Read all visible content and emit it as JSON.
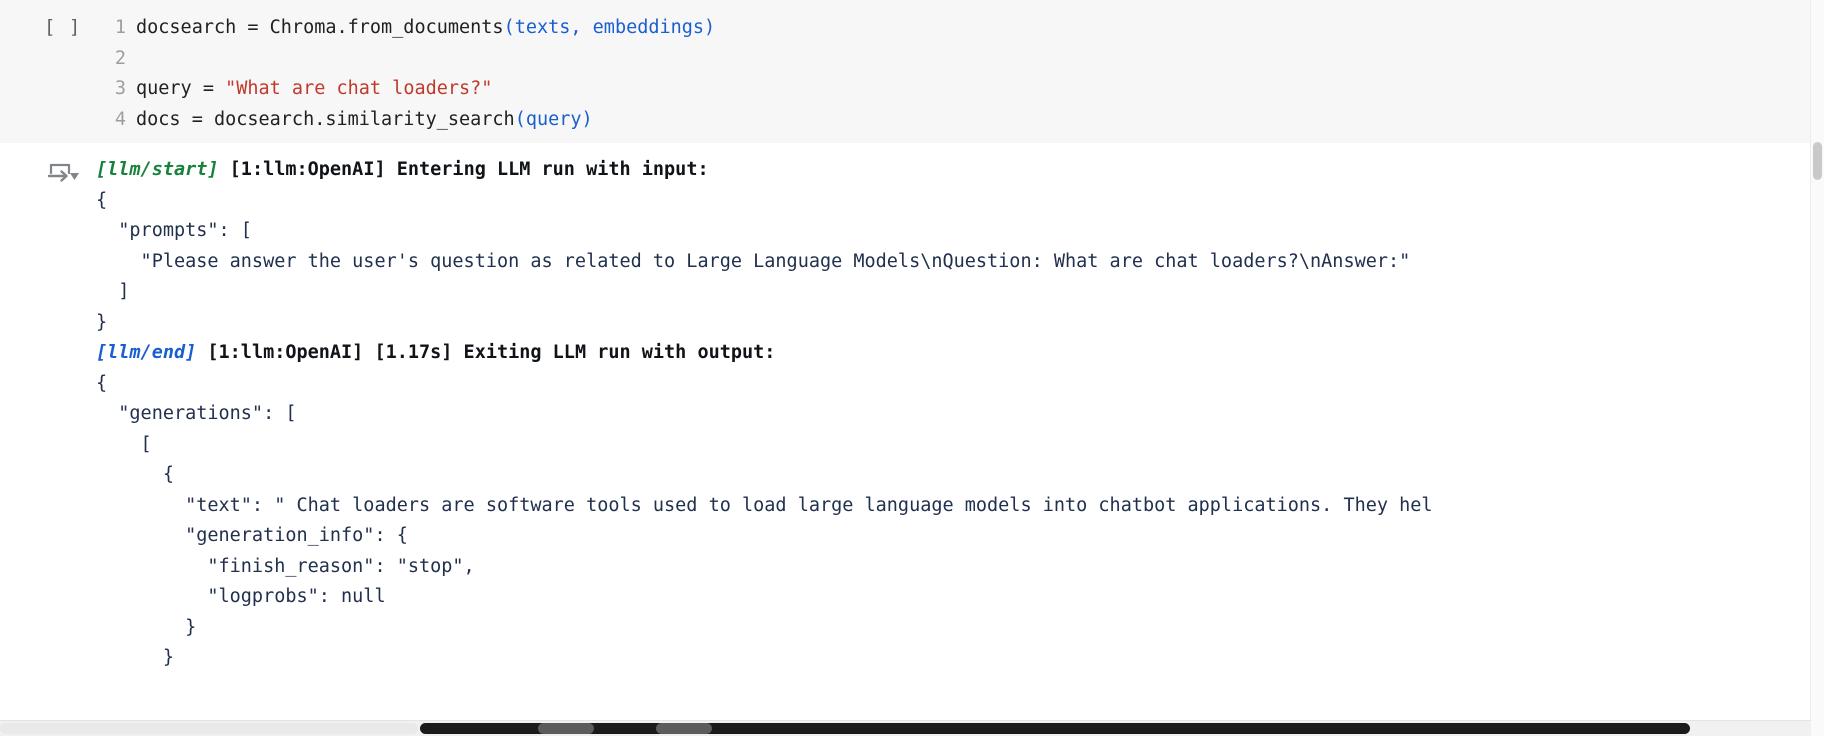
{
  "cell": {
    "run_prompt": "[ ]",
    "code_lines": [
      {
        "number": "1",
        "tokens": [
          {
            "t": "docsearch = Chroma.from_documents",
            "k": "plain"
          },
          {
            "t": "(texts, embeddings)",
            "k": "paren"
          }
        ]
      },
      {
        "number": "2",
        "tokens": [
          {
            "t": "",
            "k": "plain"
          }
        ]
      },
      {
        "number": "3",
        "tokens": [
          {
            "t": "query = ",
            "k": "plain"
          },
          {
            "t": "\"What are chat loaders?\"",
            "k": "str"
          }
        ]
      },
      {
        "number": "4",
        "tokens": [
          {
            "t": "docs = docsearch.similarity_search",
            "k": "plain"
          },
          {
            "t": "(query)",
            "k": "paren"
          }
        ]
      }
    ]
  },
  "output": {
    "icon": "output-scroll-toggle-icon",
    "lines": [
      {
        "segments": [
          {
            "t": "[llm/start]",
            "k": "start"
          },
          {
            "t": " [1:llm:OpenAI] Entering LLM run with input:",
            "k": "header"
          }
        ]
      },
      {
        "segments": [
          {
            "t": "{",
            "k": "body"
          }
        ]
      },
      {
        "segments": [
          {
            "t": "  \"prompts\": [",
            "k": "body"
          }
        ]
      },
      {
        "segments": [
          {
            "t": "    \"Please answer the user's question as related to Large Language Models\\nQuestion: What are chat loaders?\\nAnswer:\"",
            "k": "body"
          }
        ]
      },
      {
        "segments": [
          {
            "t": "  ]",
            "k": "body"
          }
        ]
      },
      {
        "segments": [
          {
            "t": "}",
            "k": "body"
          }
        ]
      },
      {
        "segments": [
          {
            "t": "[llm/end]",
            "k": "end"
          },
          {
            "t": " [1:llm:OpenAI] [1.17s] Exiting LLM run with output:",
            "k": "header"
          }
        ]
      },
      {
        "segments": [
          {
            "t": "{",
            "k": "body"
          }
        ]
      },
      {
        "segments": [
          {
            "t": "  \"generations\": [",
            "k": "body"
          }
        ]
      },
      {
        "segments": [
          {
            "t": "    [",
            "k": "body"
          }
        ]
      },
      {
        "segments": [
          {
            "t": "      {",
            "k": "body"
          }
        ]
      },
      {
        "segments": [
          {
            "t": "        \"text\": \" Chat loaders are software tools used to load large language models into chatbot applications. They hel",
            "k": "body"
          }
        ]
      },
      {
        "segments": [
          {
            "t": "        \"generation_info\": {",
            "k": "body"
          }
        ]
      },
      {
        "segments": [
          {
            "t": "          \"finish_reason\": \"stop\",",
            "k": "body"
          }
        ]
      },
      {
        "segments": [
          {
            "t": "          \"logprobs\": null",
            "k": "body"
          }
        ]
      },
      {
        "segments": [
          {
            "t": "        }",
            "k": "body"
          }
        ]
      },
      {
        "segments": [
          {
            "t": "      }",
            "k": "body"
          }
        ]
      }
    ]
  },
  "scrollbars": {
    "vertical_label": "vertical-scrollbar",
    "horizontal_label": "horizontal-scrollbar"
  },
  "colors": {
    "code_bg": "#f7f7f7",
    "string": "#c0392b",
    "paren": "#1a5fd0",
    "llm_start": "#17823b",
    "llm_end": "#1a5fd0",
    "body_text": "#21304d"
  }
}
